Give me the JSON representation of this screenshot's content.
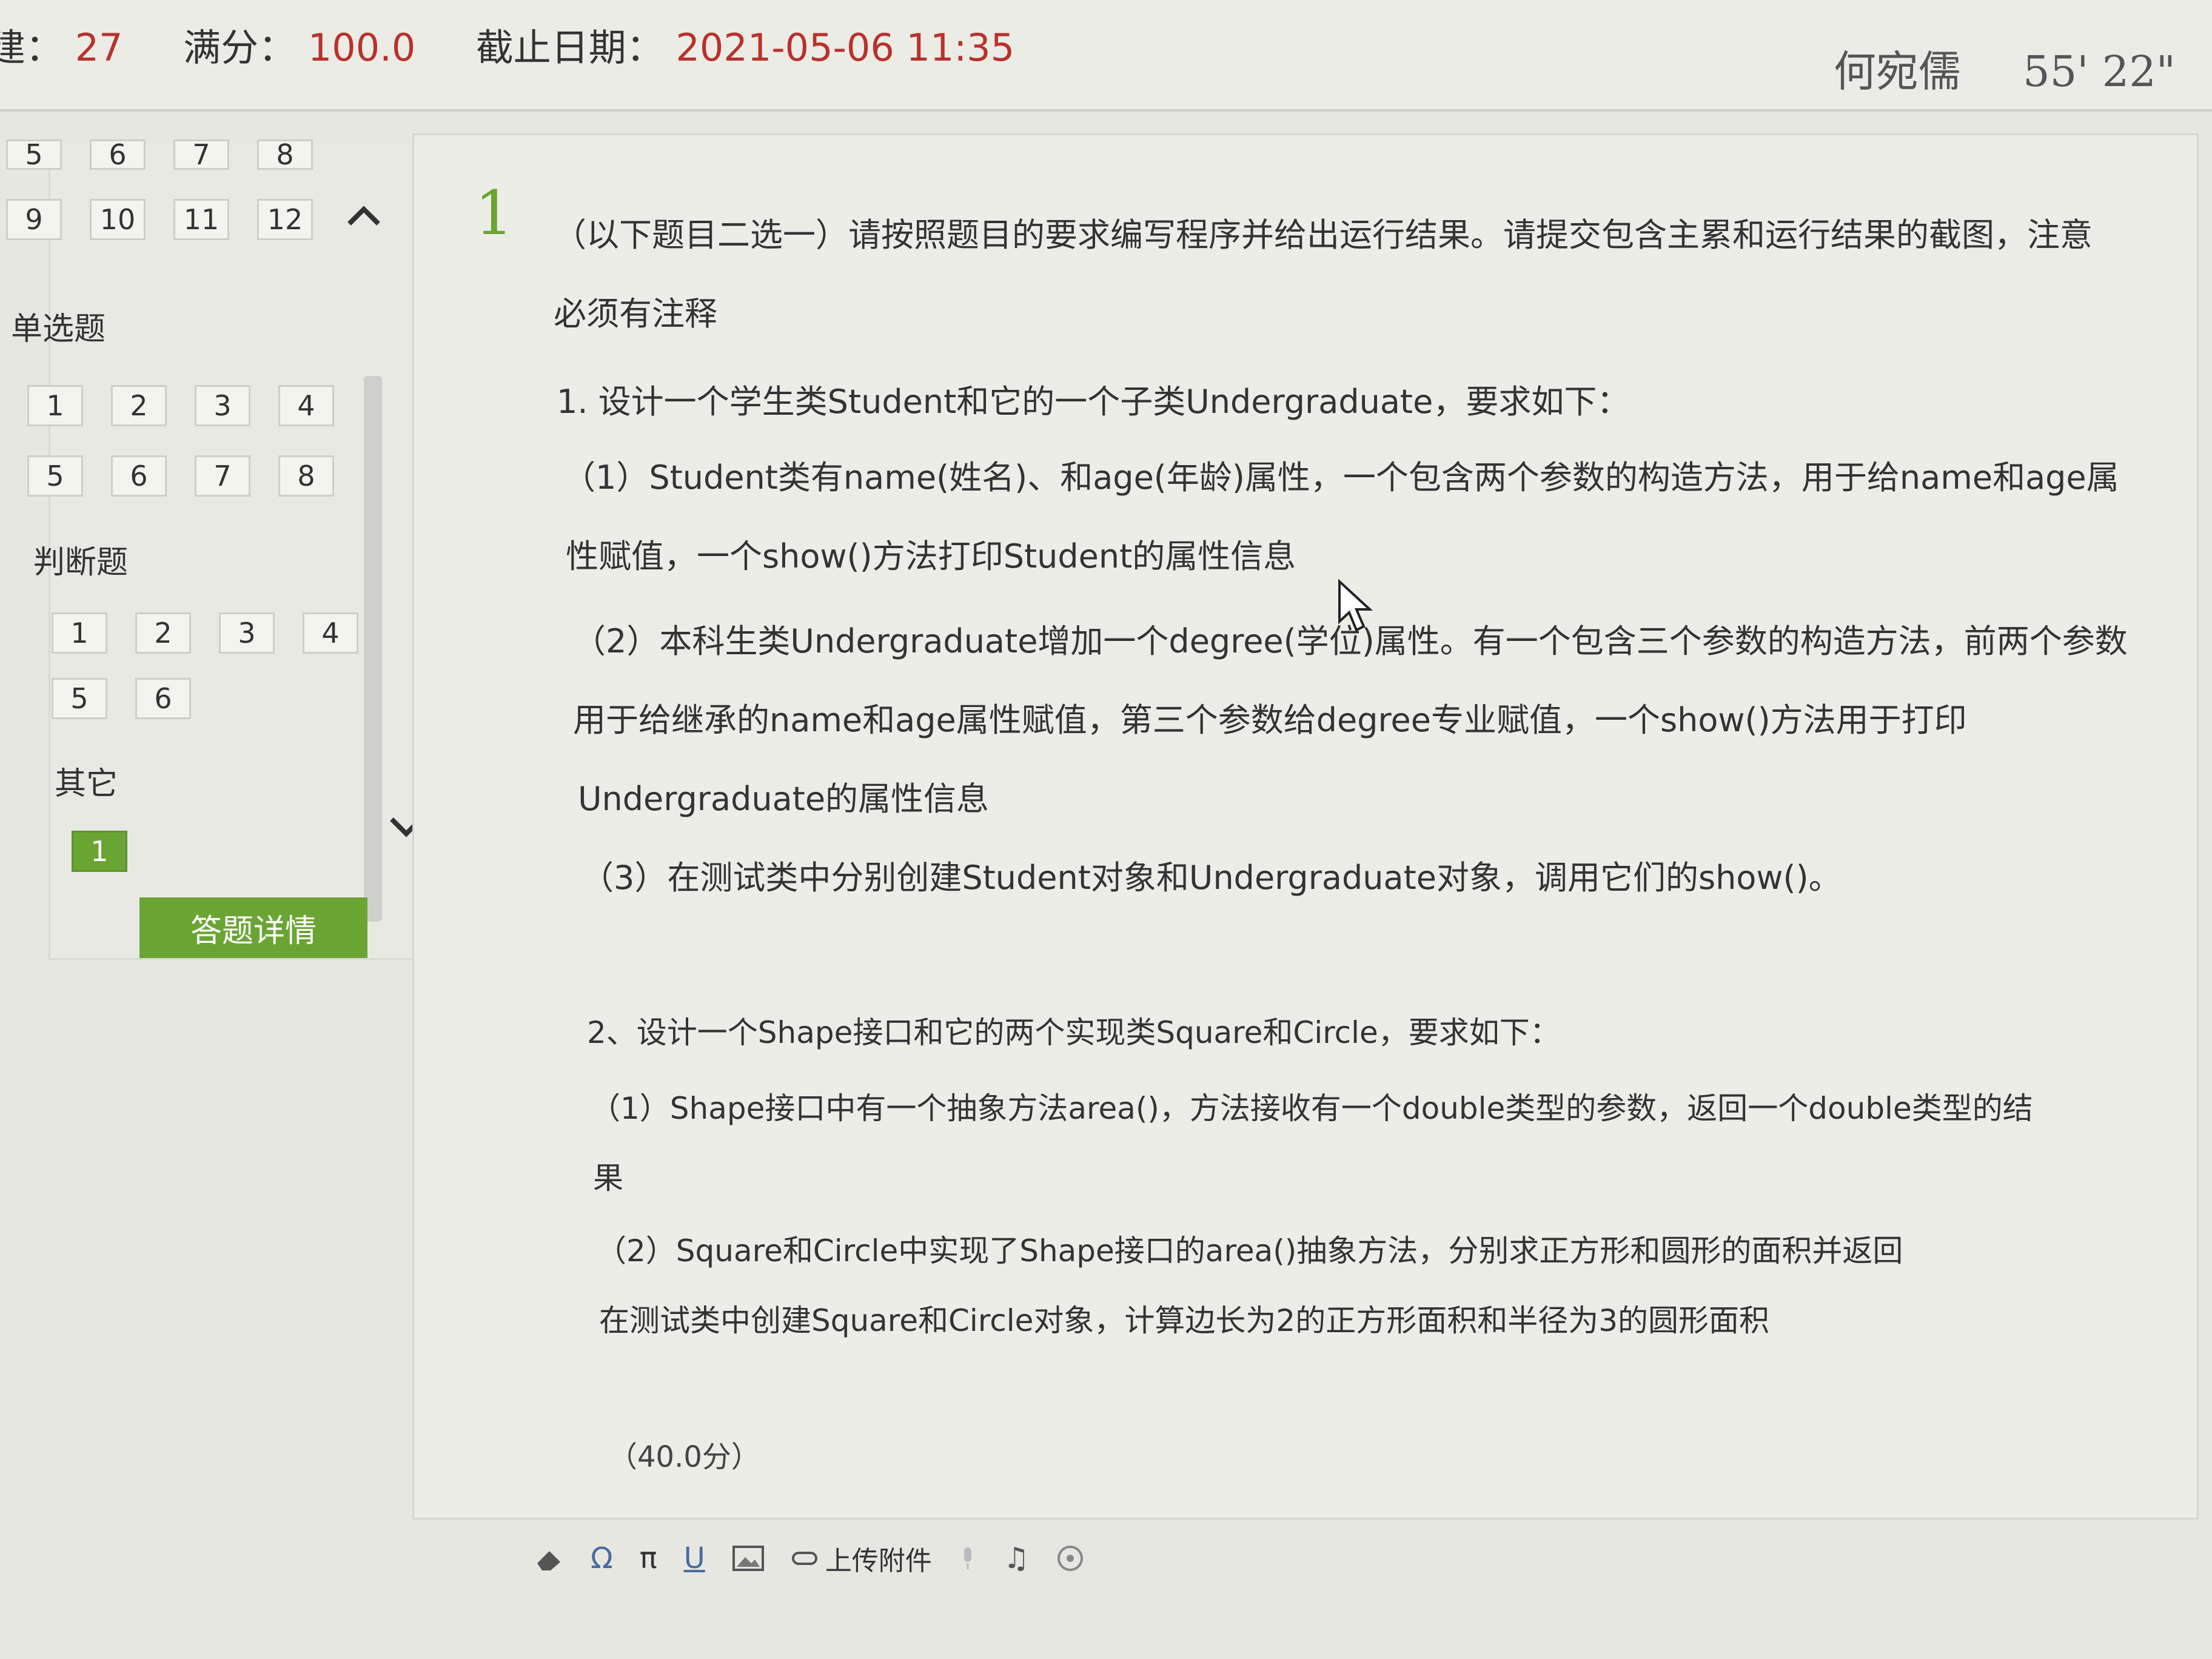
{
  "header": {
    "count_label": "建：",
    "count_value": "27",
    "full_score_label": "满分：",
    "full_score_value": "100.0",
    "deadline_label": "截止日期：",
    "deadline_value": "2021-05-06 11:35",
    "user_name": "何宛儒",
    "timer": "55' 22\""
  },
  "sidebar": {
    "top_grid": [
      "5",
      "6",
      "7",
      "8",
      "9",
      "10",
      "11",
      "12"
    ],
    "sections": [
      {
        "title": "单选题",
        "items": [
          "1",
          "2",
          "3",
          "4",
          "5",
          "6",
          "7",
          "8"
        ]
      },
      {
        "title": "判断题",
        "items": [
          "1",
          "2",
          "3",
          "4",
          "5",
          "6"
        ]
      },
      {
        "title": "其它",
        "items": [
          "1"
        ]
      }
    ],
    "detail_button": "答题详情"
  },
  "question": {
    "number": "1",
    "lines": [
      "（以下题目二选一）请按照题目的要求编写程序并给出运行结果。请提交包含主累和运行结果的截图，注意",
      "必须有注释",
      "1. 设计一个学生类Student和它的一个子类Undergraduate，要求如下：",
      "（1）Student类有name(姓名)、和age(年龄)属性，一个包含两个参数的构造方法，用于给name和age属",
      "性赋值，一个show()方法打印Student的属性信息",
      "（2）本科生类Undergraduate增加一个degree(学位)属性。有一个包含三个参数的构造方法，前两个参数",
      "用于给继承的name和age属性赋值，第三个参数给degree专业赋值，一个show()方法用于打印",
      "Undergraduate的属性信息",
      "（3）在测试类中分别创建Student对象和Undergraduate对象，调用它们的show()。",
      "2、设计一个Shape接口和它的两个实现类Square和Circle，要求如下：",
      "（1）Shape接口中有一个抽象方法area()，方法接收有一个double类型的参数，返回一个double类型的结",
      "果",
      "（2）Square和Circle中实现了Shape接口的area()抽象方法，分别求正方形和圆形的面积并返回",
      "在测试类中创建Square和Circle对象，计算边长为2的正方形面积和半径为3的圆形面积"
    ],
    "score": "（40.0分）"
  },
  "toolbar": {
    "upload_label": "上传附件"
  }
}
